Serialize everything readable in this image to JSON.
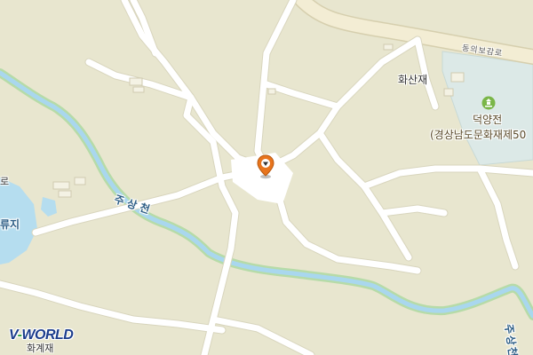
{
  "map": {
    "logo": {
      "prefix": "V",
      "dash": "-",
      "name": "WORLD"
    },
    "labels": {
      "stream_main": "주상천",
      "stream_right": "주상천",
      "reservoir": "류지",
      "village_top_right": "화산재",
      "heritage_name": "덕양전",
      "heritage_designation": "(경상남도문화재제50",
      "road_top": "동의보감로",
      "bottom_place": "화계재",
      "left_edge_text": "로"
    },
    "icons": {
      "location_marker": "location-pin-icon",
      "heritage_marker": "cultural-heritage-icon"
    },
    "colors": {
      "land": "#e8e6cf",
      "road": "#ffffff",
      "road_casing": "#d6d3bb",
      "main_road": "#f3edd4",
      "water": "#b5ddef",
      "stream_edge": "#8fd18f",
      "heritage_area": "#dce9e7",
      "marker": "#e8741c"
    }
  }
}
